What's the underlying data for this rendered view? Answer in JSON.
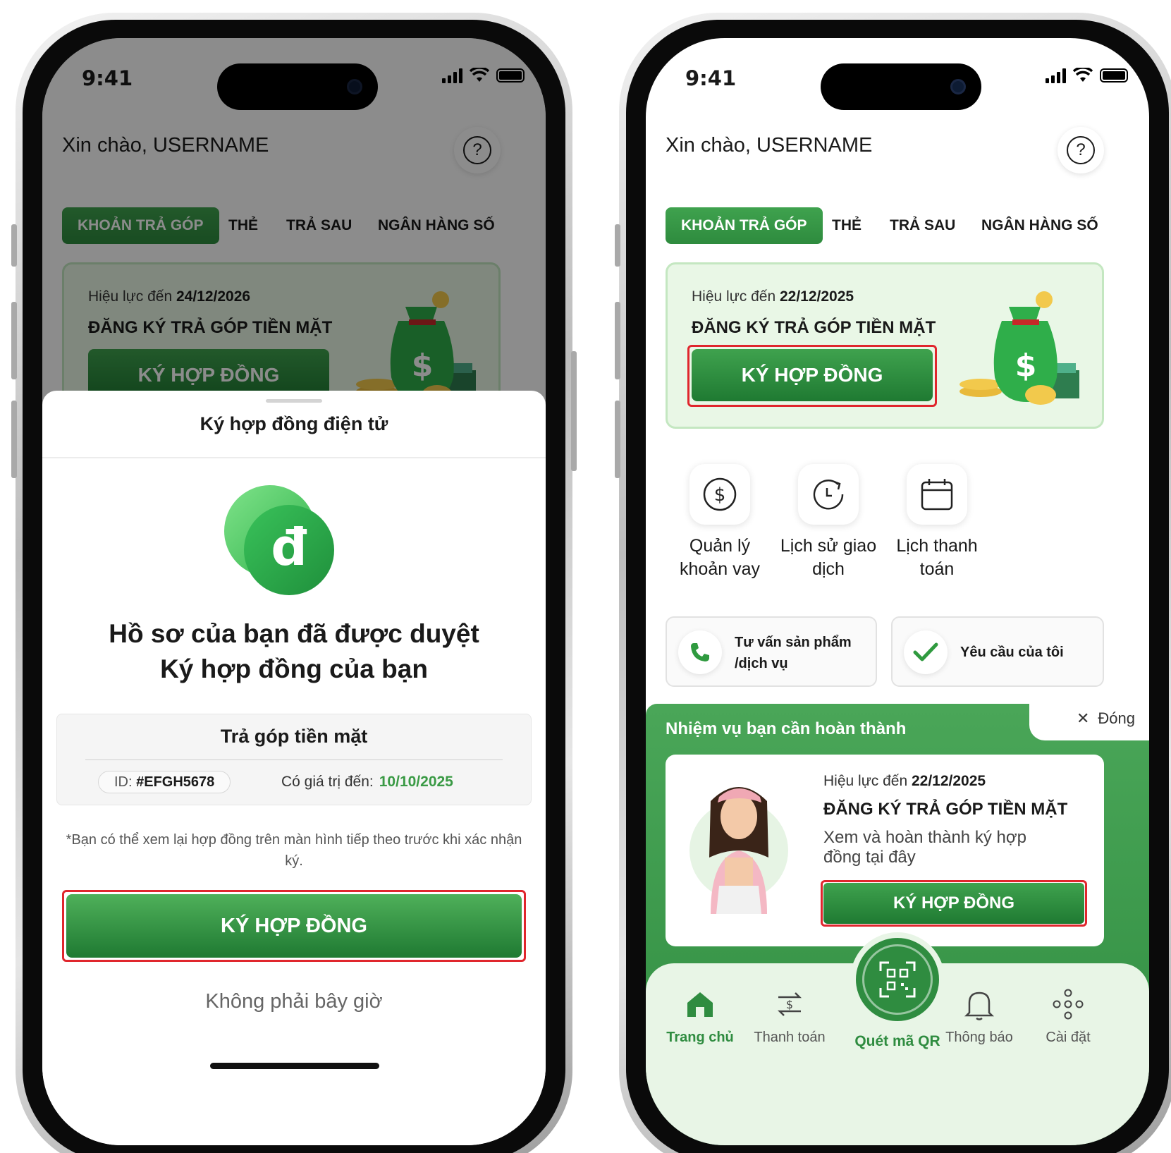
{
  "status_bar": {
    "time": "9:41"
  },
  "home": {
    "greeting": "Xin chào, USERNAME",
    "help_icon": "?",
    "tabs": [
      "KHOẢN TRẢ GÓP",
      "THẺ",
      "TRẢ SAU",
      "NGÂN HÀNG SỐ"
    ],
    "left_promo": {
      "valid_label": "Hiệu lực đến",
      "valid_date": "24/12/2026",
      "title": "ĐĂNG KÝ TRẢ GÓP TIỀN MẶT",
      "button": "KÝ HỢP ĐỒNG"
    },
    "right_promo": {
      "valid_label": "Hiệu lực đến",
      "valid_date": "22/12/2025",
      "title": "ĐĂNG KÝ TRẢ GÓP TIỀN MẶT",
      "button": "KÝ HỢP ĐỒNG"
    },
    "quick_actions": [
      {
        "label": "Quản lý khoản vay",
        "icon": "dollar-circle-icon"
      },
      {
        "label": "Lịch sử giao dịch",
        "icon": "history-clock-icon"
      },
      {
        "label": "Lịch thanh toán",
        "icon": "calendar-icon"
      }
    ],
    "support_cards": [
      {
        "label": "Tư vấn sản phẩm /dịch vụ",
        "icon": "phone-icon"
      },
      {
        "label": "Yêu cầu của tôi",
        "icon": "checkmark-icon"
      }
    ],
    "mission": {
      "title": "Nhiệm vụ bạn cần hoàn thành",
      "close_label": "Đóng",
      "valid_label": "Hiệu lực đến",
      "valid_date": "22/12/2025",
      "card_title": "ĐĂNG KÝ TRẢ GÓP TIỀN MẶT",
      "description": "Xem và hoàn thành ký hợp đồng tại đây",
      "button": "KÝ HỢP ĐỒNG"
    },
    "bottom_nav": [
      {
        "label": "Trang chủ",
        "icon": "home-icon",
        "active": true
      },
      {
        "label": "Thanh toán",
        "icon": "transfer-icon",
        "active": false
      },
      {
        "label": "Quét mã QR",
        "icon": "qr-scan-icon",
        "active": false
      },
      {
        "label": "Thông báo",
        "icon": "bell-icon",
        "active": false
      },
      {
        "label": "Cài đặt",
        "icon": "settings-dots-icon",
        "active": false
      }
    ]
  },
  "sheet": {
    "title": "Ký hợp đồng điện tử",
    "coin_symbol": "đ",
    "headline_line1": "Hồ sơ của bạn đã được duyệt",
    "headline_line2": "Ký hợp đồng của bạn",
    "product": "Trả góp tiền mặt",
    "id_label": "ID:",
    "id_value": "#EFGH5678",
    "expiry_label": "Có giá trị đến:",
    "expiry_value": "10/10/2025",
    "note": "*Bạn có thể xem lại hợp đồng trên màn hình tiếp theo trước khi xác nhận ký.",
    "primary_button": "KÝ HỢP ĐỒNG",
    "secondary_button": "Không phải bây giờ"
  },
  "colors": {
    "brand_green": "#2f8c40",
    "highlight_red": "#e0262d",
    "promo_bg": "#e9f7e6"
  }
}
